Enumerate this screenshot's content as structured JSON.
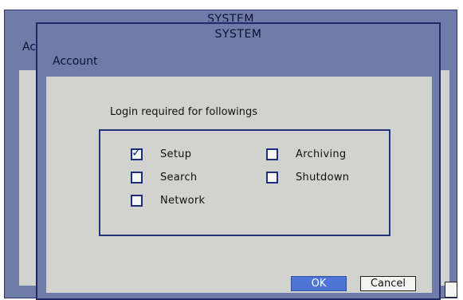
{
  "background_window": {
    "title": "SYSTEM",
    "section_label": "Ac"
  },
  "dialog": {
    "title": "SYSTEM",
    "section_label": "Account",
    "prompt": "Login required for followings",
    "options": [
      {
        "label": "Setup",
        "checked": true
      },
      {
        "label": "Archiving",
        "checked": false
      },
      {
        "label": "Search",
        "checked": false
      },
      {
        "label": "Shutdown",
        "checked": false
      },
      {
        "label": "Network",
        "checked": false
      }
    ],
    "ok_label": "OK",
    "cancel_label": "Cancel"
  },
  "colors": {
    "window_bg": "#6f7ca9",
    "panel_bg": "#d2d2ce",
    "accent": "#1b2d7c",
    "ok_button": "#4f74d8"
  }
}
